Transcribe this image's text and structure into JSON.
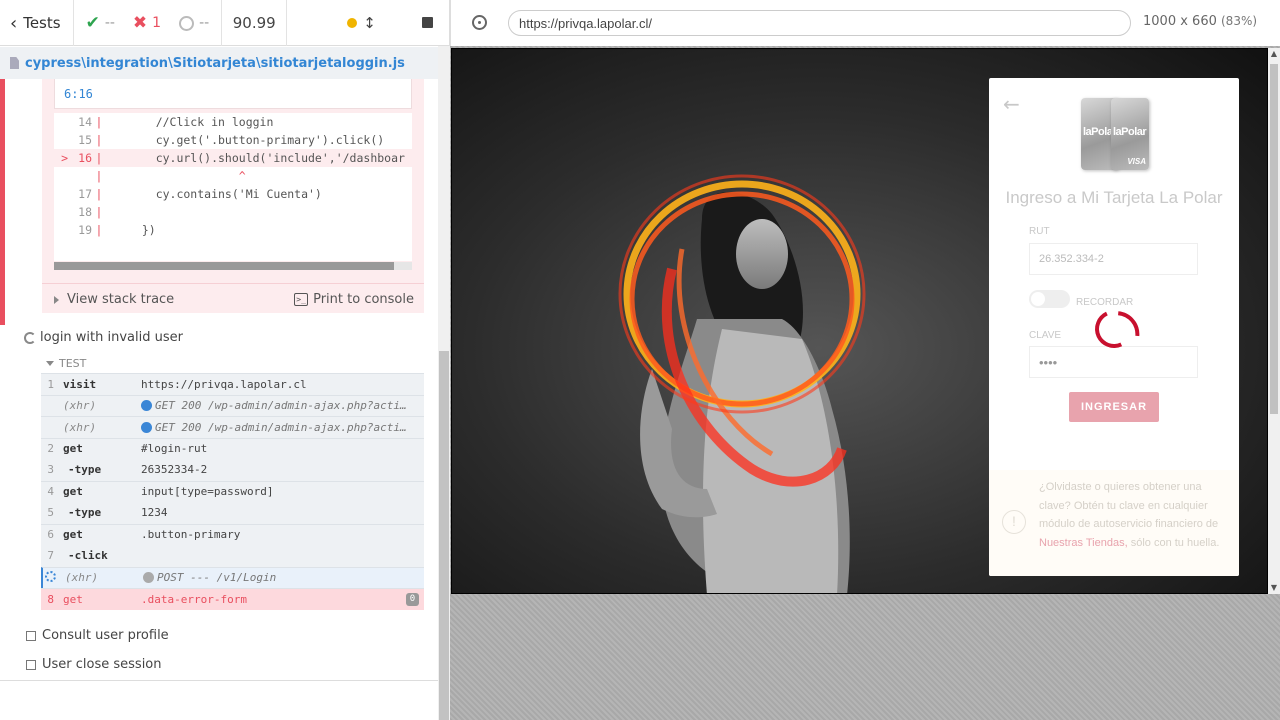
{
  "header": {
    "tests_label": "Tests",
    "passed": "--",
    "failed": "1",
    "pending": "--",
    "duration": "90.99"
  },
  "spec": {
    "path": "cypress\\integration\\Sitiotarjeta\\sitiotarjetaloggin.js"
  },
  "code_frame": {
    "location": "6:16",
    "lines": [
      {
        "marker": "",
        "num": "14",
        "text": "    //Click in loggin"
      },
      {
        "marker": "",
        "num": "15",
        "text": "    cy.get('.button-primary').click()"
      },
      {
        "marker": ">",
        "num": "16",
        "text": "    cy.url().should('include','/dashboar"
      },
      {
        "marker": "",
        "num": "",
        "text": "                ^"
      },
      {
        "marker": "",
        "num": "17",
        "text": "    cy.contains('Mi Cuenta')"
      },
      {
        "marker": "",
        "num": "18",
        "text": ""
      },
      {
        "marker": "",
        "num": "19",
        "text": "  })"
      }
    ],
    "view_stack_trace": "View stack trace",
    "print_to_console": "Print to console"
  },
  "test": {
    "title": "login with invalid user",
    "section_label": "TEST",
    "commands": [
      {
        "num": "1",
        "name": "visit",
        "message": "https://privqa.lapolar.cl",
        "kind": "cmd",
        "group_start": true
      },
      {
        "num": "",
        "name": "(xhr)",
        "message": "GET 200 /wp-admin/admin-ajax.php?acti…",
        "kind": "xhr",
        "group_start": true
      },
      {
        "num": "",
        "name": "(xhr)",
        "message": "GET 200 /wp-admin/admin-ajax.php?acti…",
        "kind": "xhr",
        "group_start": true
      },
      {
        "num": "2",
        "name": "get",
        "message": "#login-rut",
        "kind": "cmd",
        "group_start": true
      },
      {
        "num": "3",
        "name": "-type",
        "message": "26352334-2",
        "kind": "child",
        "group_start": false
      },
      {
        "num": "4",
        "name": "get",
        "message": "input[type=password]",
        "kind": "cmd",
        "group_start": true
      },
      {
        "num": "5",
        "name": "-type",
        "message": "1234",
        "kind": "child",
        "group_start": false
      },
      {
        "num": "6",
        "name": "get",
        "message": ".button-primary",
        "kind": "cmd",
        "group_start": true
      },
      {
        "num": "7",
        "name": "-click",
        "message": "",
        "kind": "child",
        "group_start": false
      },
      {
        "num": "",
        "name": "(xhr)",
        "message": "POST --- /v1/Login",
        "kind": "pending",
        "group_start": true
      },
      {
        "num": "8",
        "name": "get",
        "message": ".data-error-form",
        "kind": "failed",
        "group_start": true,
        "badge": "0"
      }
    ]
  },
  "other_tests": [
    "Consult user profile",
    "User close session"
  ],
  "aut": {
    "url": "https://privqa.lapolar.cl/",
    "viewport": "1000 x 660",
    "scale": "(83%)"
  },
  "login": {
    "card_brand": "laPolar",
    "card_network": "VISA",
    "title": "Ingreso a Mi Tarjeta La Polar",
    "rut_label": "RUT",
    "rut_value": "26.352.334-2",
    "remember_label": "RECORDAR",
    "password_label": "CLAVE",
    "password_value": "••••",
    "submit_label": "INGRESAR",
    "help_text": "¿Olvidaste o quieres obtener una clave? Obtén tu clave en cualquier módulo de autoservicio financiero de ",
    "help_link": "Nuestras Tiendas,",
    "help_suffix": " sólo con tu huella."
  },
  "colors": {
    "pass": "#2ea44f",
    "fail": "#e94f5f",
    "link": "#3386d4",
    "brand_red": "#c8102e"
  }
}
